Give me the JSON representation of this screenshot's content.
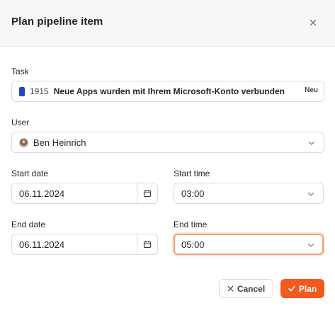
{
  "dialog": {
    "title": "Plan pipeline item"
  },
  "task": {
    "label": "Task",
    "id": "1915",
    "title": "Neue Apps wurden mit Ihrem Microsoft-Konto verbunden",
    "badge": "Neu",
    "color": "#2346c8"
  },
  "user": {
    "label": "User",
    "name": "Ben Heinrich"
  },
  "start_date": {
    "label": "Start date",
    "value": "06.11.2024"
  },
  "start_time": {
    "label": "Start time",
    "value": "03:00"
  },
  "end_date": {
    "label": "End date",
    "value": "06.11.2024"
  },
  "end_time": {
    "label": "End time",
    "value": "05:00"
  },
  "actions": {
    "cancel_label": "Cancel",
    "plan_label": "Plan",
    "plan_color": "#f05a1e"
  },
  "icons": {
    "close": "close-icon",
    "chevron": "chevron-down-icon",
    "calendar": "calendar-icon",
    "cancel": "x-icon",
    "plan": "check-icon"
  }
}
